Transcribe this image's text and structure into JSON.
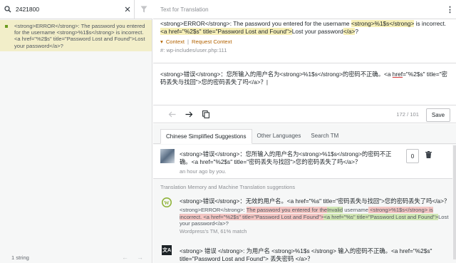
{
  "search": {
    "value": "2421800"
  },
  "list": {
    "items": [
      {
        "text": "<strong>ERROR</strong>: The password you entered for the username <strong>%1$s</strong> is incorrect. <a href=\"%2$s\" title=\"Password Lost and Found\">Lost your password</a>?"
      }
    ],
    "footer_count": "1 string",
    "prev": "←",
    "next": "→"
  },
  "header": {
    "label": "Text for Translation"
  },
  "original": {
    "p1": "<strong>ERROR</strong>: The password you entered for the username ",
    "p2": "<strong>%1$s</strong>",
    "p3": " is incorrect. ",
    "p4": "<a href=\"%2$s\" title=\"Password Lost and Found\">",
    "p5": "Lost your password",
    "p6": "</a>",
    "p7": "?"
  },
  "context": {
    "context_label": "Context",
    "separator": "|",
    "request_label": "Request Context"
  },
  "reference": "#: wp-includes/user.php:111",
  "editor": {
    "part1": "<strong>错误</strong>：您所输入的用户名为<strong>%1$s</strong>的密码不正确。<a ",
    "href_word": "href",
    "part2": "=\"%2$s\" title=\"密码丢失与找回\">您的密码丢失了吗</a>？"
  },
  "toolbar": {
    "counter": "172 / 101",
    "save_label": "Save"
  },
  "tabs": [
    {
      "label": "Chinese Simplified Suggestions"
    },
    {
      "label": "Other Languages"
    },
    {
      "label": "Search TM"
    }
  ],
  "own_suggestion": {
    "text": "<strong>错误</strong>：您所输入的用户名为<strong>%1$s</strong>的密码不正确。<a href=\"%2$s\" title=\"密码丢失与找回\">您的密码丢失了吗</a>？",
    "meta": "an hour ago by you.",
    "votes": "0"
  },
  "section_title": "Translation Memory and Machine Translation suggestions",
  "tm_suggestion": {
    "text": "<strong>错误</strong>：无效的用户名。<a href=\"%s\" title=\"密码丢失与找回\">您的密码丢失了吗</a>？",
    "d1": "<strong>ERROR</strong>: ",
    "d2": "The password you entered for the",
    "d3": "Invalid",
    "d4": " username",
    "d5": " <strong>%1$s</strong> is incorrect. <a href=\"%2$s\" title=\"Password Lost and Found\">",
    "d6": "<a href=\"%s\" title=\"Password Lost and Found\">",
    "d7": "Lost your password</a>?",
    "meta": "Wordpress's TM, 61% match"
  },
  "mt_suggestion": {
    "logo": "文A",
    "text": "<strong> 错误 </strong>: 为用户名 <strong>%1$s </strong> 输入的密码不正确。<a href=\"%2$s\" title=\"Password Lost and Found\"> 丢失密码 </a>？"
  },
  "colors": {
    "highlight": "#f7f0b8",
    "selected_row": "#f2eec9",
    "accent_orange": "#b26200",
    "insert": "#d1e7b4",
    "delete": "#f4c6c3"
  }
}
